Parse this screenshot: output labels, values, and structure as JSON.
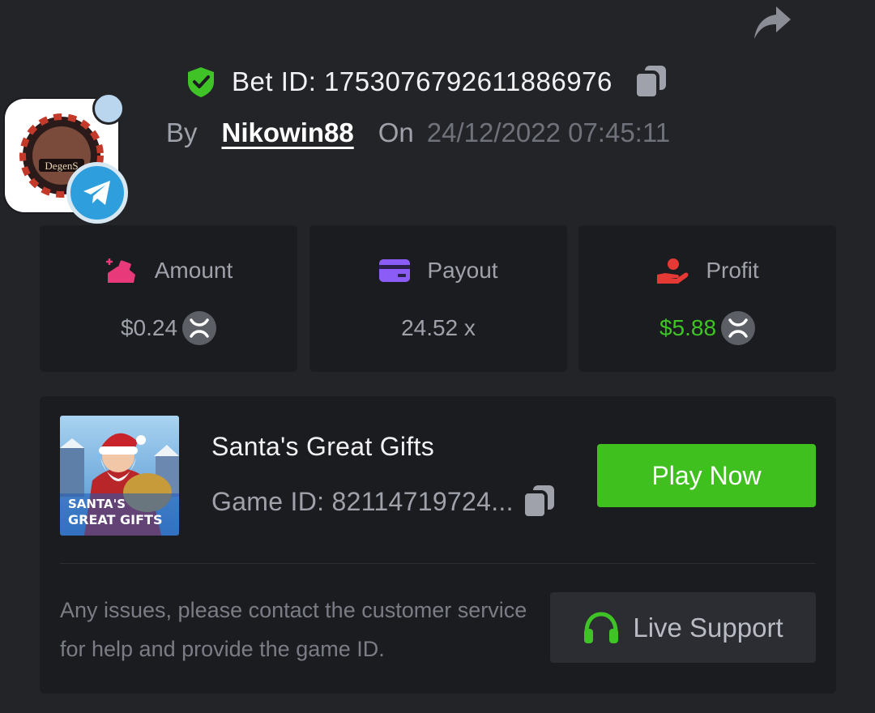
{
  "header": {
    "bet_id_text": "Bet ID: 1753076792611886976",
    "by_label": "By",
    "username": "Nikowin88",
    "on_label": "On",
    "datetime": "24/12/2022 07:45:11"
  },
  "avatar": {
    "logo_text": "DegenS"
  },
  "stats": {
    "amount": {
      "label": "Amount",
      "value": "$0.24"
    },
    "payout": {
      "label": "Payout",
      "value": "24.52 x"
    },
    "profit": {
      "label": "Profit",
      "value": "$5.88"
    }
  },
  "game": {
    "title": "Santa's Great Gifts",
    "game_id_text": "Game ID: 82114719724...",
    "thumb_text_line1": "SANTA'S",
    "thumb_text_line2": "GREAT GIFTS",
    "play_label": "Play Now"
  },
  "support": {
    "help_text": "Any issues, please contact the customer service for help and provide the game ID.",
    "live_support_label": "Live Support"
  },
  "colors": {
    "background": "#232428",
    "card": "#1b1c1f",
    "accent_green": "#3fc01f",
    "profit_green": "#3fc326",
    "telegram_blue": "#2e9fdc"
  },
  "icons": [
    "share-icon",
    "verified-shield-icon",
    "copy-icon",
    "telegram-icon",
    "amount-icon",
    "payout-card-icon",
    "profit-hand-icon",
    "xrp-coin-icon",
    "headset-icon"
  ]
}
